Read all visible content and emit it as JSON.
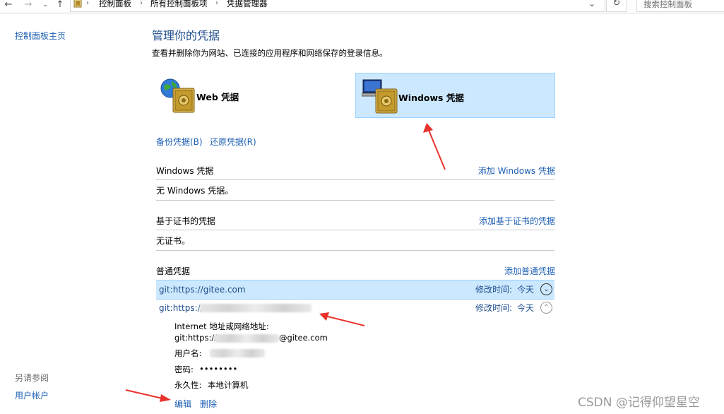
{
  "search": {
    "placeholder": "搜索控制面板"
  },
  "breadcrumb": [
    "控制面板",
    "所有控制面板项",
    "凭据管理器"
  ],
  "sidebar": {
    "home": "控制面板主页",
    "see_also_title": "另请参阅",
    "see_also_items": [
      "用户帐户"
    ]
  },
  "main": {
    "title": "管理你的凭据",
    "description": "查看并删除你为网站、已连接的应用程序和网络保存的登录信息。",
    "web_cred_label": "Web 凭据",
    "windows_cred_label": "Windows 凭据",
    "backup_link": "备份凭据(B)",
    "restore_link": "还原凭据(R)",
    "sections": [
      {
        "title": "Windows 凭据",
        "add_link": "添加 Windows 凭据",
        "empty_text": "无 Windows 凭据。"
      },
      {
        "title": "基于证书的凭据",
        "add_link": "添加基于证书的凭据",
        "empty_text": "无证书。"
      },
      {
        "title": "普通凭据",
        "add_link": "添加普通凭据"
      }
    ],
    "generic_items": [
      {
        "name": "git:https://gitee.com",
        "modified_label": "修改时间:",
        "modified_value": "今天",
        "expanded": false
      },
      {
        "name": "git:https://",
        "modified_label": "修改时间:",
        "modified_value": "今天",
        "expanded": true
      }
    ],
    "details": {
      "address_label": "Internet 地址或网络地址:",
      "address_prefix": "git:https://",
      "address_suffix": "@gitee.com",
      "username_label": "用户名:",
      "password_label": "密码:",
      "password_value": "••••••••",
      "persistence_label": "永久性:",
      "persistence_value": "本地计算机",
      "edit_link": "编辑",
      "delete_link": "删除"
    }
  },
  "watermark": "CSDN @记得仰望星空",
  "colors": {
    "accent_link": "#1e5fb3",
    "selected_bg": "#cce8ff",
    "annotation_arrow": "#e8322c"
  }
}
